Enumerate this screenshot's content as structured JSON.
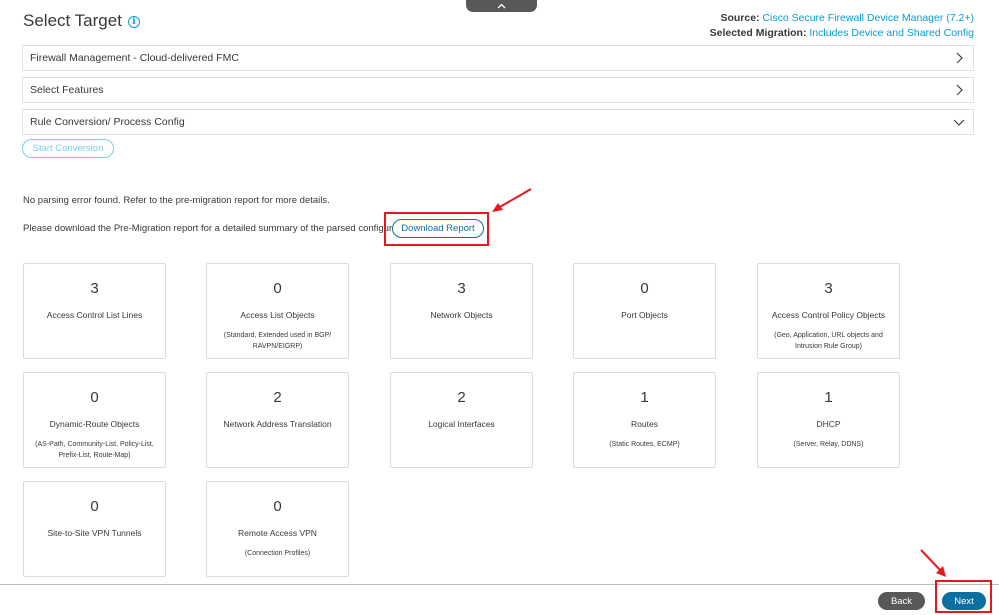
{
  "header": {
    "title": "Select Target",
    "source_label": "Source:",
    "source_value": "Cisco Secure Firewall Device Manager (7.2+)",
    "migration_label": "Selected Migration:",
    "migration_value": "Includes Device and Shared Config"
  },
  "accordions": [
    {
      "label": "Firewall Management - Cloud-delivered FMC",
      "state": "collapsed"
    },
    {
      "label": "Select Features",
      "state": "collapsed"
    },
    {
      "label": "Rule Conversion/ Process Config",
      "state": "expanded"
    }
  ],
  "start_conversion_label": "Start Conversion",
  "messages": {
    "no_error": "No parsing error found. Refer to the pre-migration report for more details.",
    "download_prompt": "Please download the Pre-Migration report for a detailed summary of the parsed configuration."
  },
  "download_report_label": "Download Report",
  "cards": [
    {
      "count": "3",
      "label": "Access Control List Lines",
      "sub": ""
    },
    {
      "count": "0",
      "label": "Access List Objects",
      "sub": "(Standard, Extended used in BGP/ RAVPN/EIGRP)"
    },
    {
      "count": "3",
      "label": "Network Objects",
      "sub": ""
    },
    {
      "count": "0",
      "label": "Port Objects",
      "sub": ""
    },
    {
      "count": "3",
      "label": "Access Control Policy Objects",
      "sub": "(Geo, Application, URL objects and Intrusion Rule Group)"
    },
    {
      "count": "0",
      "label": "Dynamic-Route Objects",
      "sub": "(AS-Path, Community-List, Policy-List, Prefix-List, Route-Map)"
    },
    {
      "count": "2",
      "label": "Network Address Translation",
      "sub": ""
    },
    {
      "count": "2",
      "label": "Logical Interfaces",
      "sub": ""
    },
    {
      "count": "1",
      "label": "Routes",
      "sub": "(Static Routes, ECMP)"
    },
    {
      "count": "1",
      "label": "DHCP",
      "sub": "(Server, Relay, DDNS)"
    },
    {
      "count": "0",
      "label": "Site-to-Site VPN Tunnels",
      "sub": ""
    },
    {
      "count": "0",
      "label": "Remote Access VPN",
      "sub": "(Connection Profiles)"
    }
  ],
  "footer": {
    "back_label": "Back",
    "next_label": "Next"
  },
  "colors": {
    "accent": "#049fd9",
    "primary_button": "#0d6fa0",
    "secondary_button": "#58585b",
    "annotation_red": "#e8171f"
  }
}
